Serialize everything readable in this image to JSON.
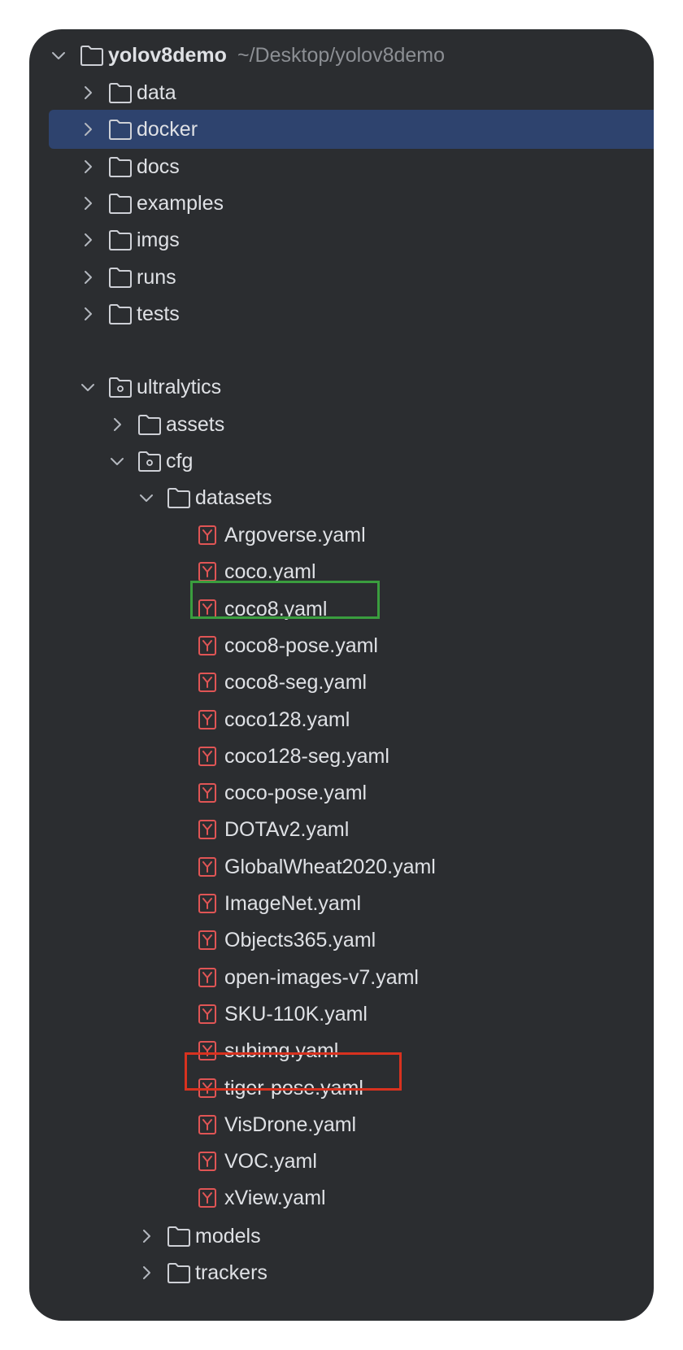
{
  "project": {
    "name": "yolov8demo",
    "path": "~/Desktop/yolov8demo"
  },
  "top_folders": [
    {
      "name": "data"
    },
    {
      "name": "docker",
      "selected": true
    },
    {
      "name": "docs"
    },
    {
      "name": "examples"
    },
    {
      "name": "imgs"
    },
    {
      "name": "runs"
    },
    {
      "name": "tests"
    }
  ],
  "ultralytics": {
    "name": "ultralytics",
    "assets": "assets",
    "cfg": "cfg",
    "datasets": "datasets",
    "files": [
      "Argoverse.yaml",
      "coco.yaml",
      "coco8.yaml",
      "coco8-pose.yaml",
      "coco8-seg.yaml",
      "coco128.yaml",
      "coco128-seg.yaml",
      "coco-pose.yaml",
      "DOTAv2.yaml",
      "GlobalWheat2020.yaml",
      "ImageNet.yaml",
      "Objects365.yaml",
      "open-images-v7.yaml",
      "SKU-110K.yaml",
      "subimg.yaml",
      "tiger-pose.yaml",
      "VisDrone.yaml",
      "VOC.yaml",
      "xView.yaml"
    ],
    "models": "models",
    "trackers": "trackers"
  },
  "highlights": {
    "green": "coco8.yaml",
    "red": "subimg.yaml"
  },
  "colors": {
    "panel_bg": "#2b2d30",
    "selection": "#2e436e",
    "text": "#dfe1e5",
    "path_hint": "#8c8f94",
    "yaml_icon": "#e05555",
    "highlight_green": "#3a9d3e",
    "highlight_red": "#d8321f"
  },
  "icons": {
    "collapsed": "chevron-right-icon",
    "expanded": "chevron-down-icon",
    "folder": "folder-icon",
    "package": "package-folder-icon",
    "yaml": "yaml-file-icon"
  }
}
